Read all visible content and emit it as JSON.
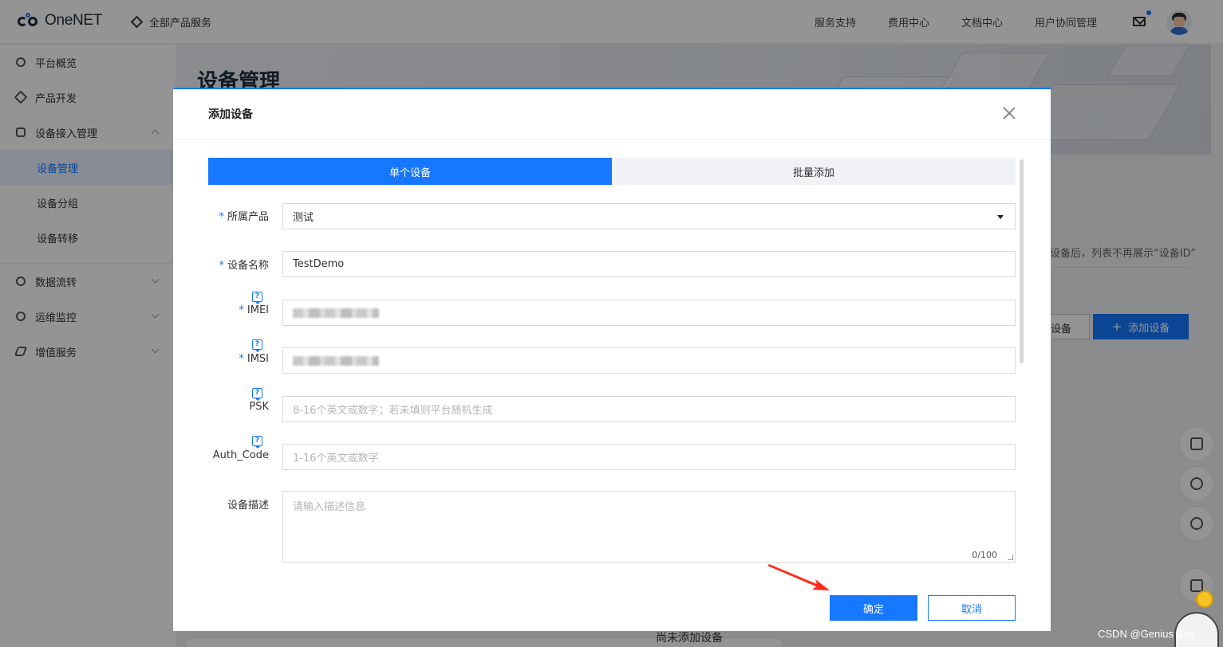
{
  "header": {
    "logo_text": "OneNET",
    "all_products": "全部产品服务",
    "nav": [
      "服务支持",
      "费用中心",
      "文档中心",
      "用户协同管理"
    ]
  },
  "sidebar": {
    "items": [
      {
        "label": "平台概览"
      },
      {
        "label": "产品开发"
      },
      {
        "label": "设备接入管理"
      },
      {
        "label": "设备管理",
        "active": true
      },
      {
        "label": "设备分组"
      },
      {
        "label": "设备转移"
      },
      {
        "label": "数据流转"
      },
      {
        "label": "运维监控"
      },
      {
        "label": "增值服务"
      }
    ]
  },
  "page": {
    "title": "设备管理",
    "hint": "设备后，列表不再展示“设备ID”",
    "btn_secondary": "设备",
    "btn_add": "添加设备",
    "empty_text": "尚未添加设备"
  },
  "modal": {
    "title": "添加设备",
    "tabs": [
      "单个设备",
      "批量添加"
    ],
    "fields": {
      "product": {
        "label": "所属产品",
        "value": "测试",
        "required": true
      },
      "device_name": {
        "label": "设备名称",
        "value": "TestDemo",
        "required": true
      },
      "imei": {
        "label": "IMEI",
        "required": true
      },
      "imsi": {
        "label": "IMSI",
        "required": true
      },
      "psk": {
        "label": "PSK",
        "placeholder": "8-16个英文或数字；若未填则平台随机生成"
      },
      "auth_code": {
        "label": "Auth_Code",
        "placeholder": "1-16个英文或数字"
      },
      "description": {
        "label": "设备描述",
        "placeholder": "请输入描述信息",
        "counter": "0/100"
      }
    },
    "confirm": "确定",
    "cancel": "取消"
  },
  "watermark": "CSDN @Genius Sue",
  "colors": {
    "primary": "#1677ff",
    "arrow": "#ff2a1a"
  }
}
